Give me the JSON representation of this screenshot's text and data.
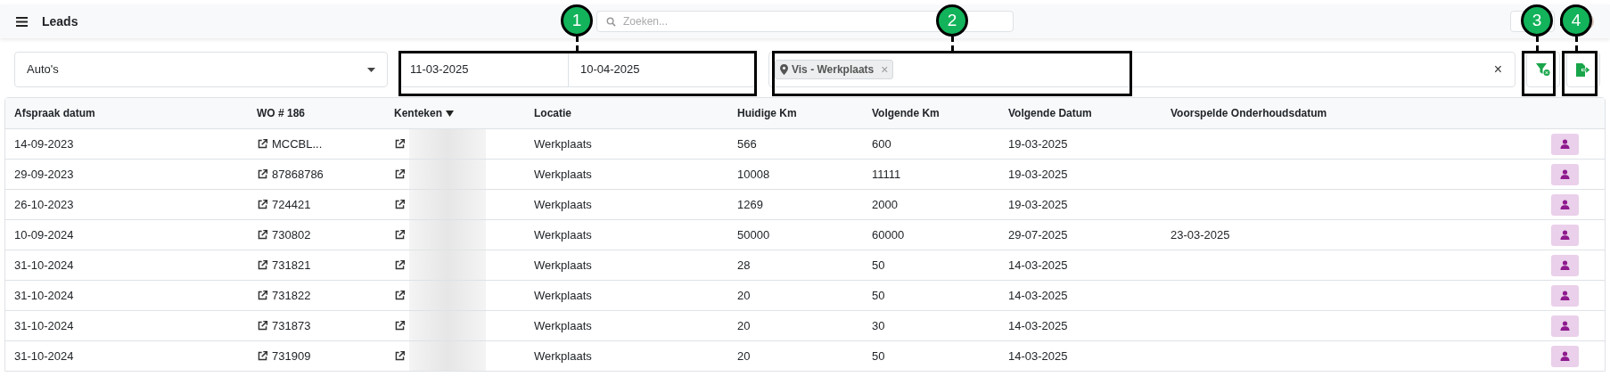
{
  "topbar": {
    "title": "Leads",
    "search": {
      "placeholder": "Zoeken..."
    }
  },
  "filters": {
    "vehicle_type": "Auto's",
    "date_from": "11-03-2025",
    "date_to": "10-04-2025",
    "tags": [
      {
        "label": "Vis - Werkplaats",
        "remove": "×"
      }
    ],
    "clear": "×"
  },
  "table": {
    "columns": [
      {
        "label": "Afspraak datum",
        "sorted": false
      },
      {
        "label": "WO # 186",
        "sorted": false
      },
      {
        "label": "Kenteken",
        "sorted": true
      },
      {
        "label": "Locatie",
        "sorted": false
      },
      {
        "label": "Huidige Km",
        "sorted": false
      },
      {
        "label": "Volgende Km",
        "sorted": false
      },
      {
        "label": "Volgende Datum",
        "sorted": false
      },
      {
        "label": "Voorspelde Onderhoudsdatum",
        "sorted": false
      }
    ],
    "rows": [
      {
        "date": "14-09-2023",
        "wo": "MCCBL...",
        "location": "Werkplaats",
        "km": "566",
        "next_km": "600",
        "next_date": "19-03-2025"
      },
      {
        "date": "29-09-2023",
        "wo": "87868786",
        "location": "Werkplaats",
        "km": "10008",
        "next_km": "11111",
        "next_date": "19-03-2025"
      },
      {
        "date": "26-10-2023",
        "wo": "724421",
        "location": "Werkplaats",
        "km": "1269",
        "next_km": "2000",
        "next_date": "19-03-2025"
      },
      {
        "date": "10-09-2024",
        "wo": "730802",
        "location": "Werkplaats",
        "km": "50000",
        "next_km": "60000",
        "next_date": "29-07-2025",
        "forecast": "23-03-2025"
      },
      {
        "date": "31-10-2024",
        "wo": "731821",
        "location": "Werkplaats",
        "km": "28",
        "next_km": "50",
        "next_date": "14-03-2025"
      },
      {
        "date": "31-10-2024",
        "wo": "731822",
        "location": "Werkplaats",
        "km": "20",
        "next_km": "50",
        "next_date": "14-03-2025"
      },
      {
        "date": "31-10-2024",
        "wo": "731873",
        "location": "Werkplaats",
        "km": "20",
        "next_km": "30",
        "next_date": "14-03-2025"
      },
      {
        "date": "31-10-2024",
        "wo": "731909",
        "location": "Werkplaats",
        "km": "20",
        "next_km": "50",
        "next_date": "14-03-2025"
      }
    ]
  },
  "callouts": [
    {
      "label": "1"
    },
    {
      "label": "2"
    },
    {
      "label": "3"
    },
    {
      "label": "4"
    }
  ]
}
